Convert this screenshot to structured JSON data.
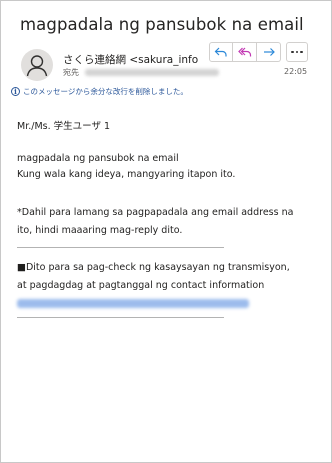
{
  "subject": "magpadala ng pansubok na email",
  "header": {
    "sender": "さくら連絡網 <sakura_info",
    "to_label": "宛先",
    "time": "22:05",
    "notice": "このメッセージから余分な改行を削除しました。"
  },
  "actions": {
    "reply": "reply-icon",
    "reply_all": "reply-all-icon",
    "forward": "forward-icon",
    "more": "more-icon"
  },
  "body": {
    "greeting": "Mr./Ms. 学生ユーザ 1",
    "line1": "magpadala ng pansubok na email",
    "line2": "Kung wala kang ideya, mangyaring itapon ito.",
    "note1": "*Dahil para lamang sa pagpapadala ang email address na",
    "note2": "ito, hindi maaaring mag-reply dito.",
    "footer1": "■Dito para sa pag-check ng kasaysayan ng transmisyon,",
    "footer2": "at pagdagdag at pagtanggal ng contact information"
  },
  "colors": {
    "accent": "#2b579a",
    "reply": "#2b88d8",
    "reply_all": "#c239b3",
    "forward": "#2b88d8"
  }
}
